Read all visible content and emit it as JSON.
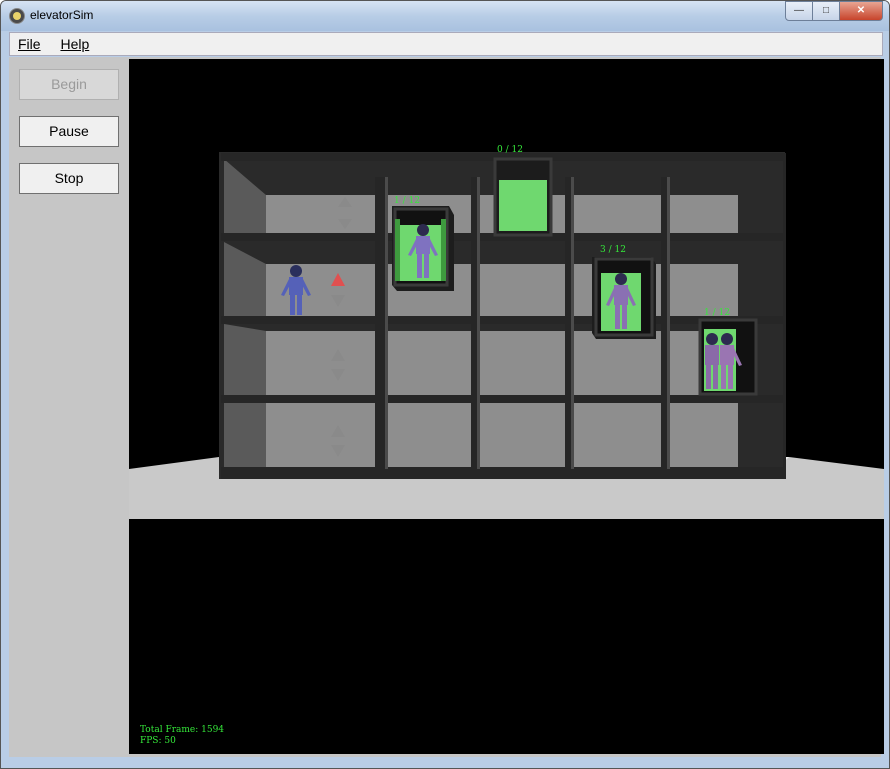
{
  "window": {
    "title": "elevatorSim"
  },
  "title_buttons": {
    "minimize": "—",
    "maximize": "□",
    "close": "✕"
  },
  "menu": {
    "file": "File",
    "help": "Help"
  },
  "sidebar": {
    "begin": "Begin",
    "pause": "Pause",
    "stop": "Stop"
  },
  "hud": {
    "total_frame": "Total Frame: 1594",
    "fps": "FPS: 50"
  },
  "elevators": [
    {
      "label": "0 / 12"
    },
    {
      "label": "1 / 12"
    },
    {
      "label": "3 / 12"
    },
    {
      "label": "1 / 12"
    }
  ],
  "colors": {
    "elevator_green": "#6fd86f",
    "call_up_active": "#e05050",
    "call_inactive": "#8a8a8a",
    "hud_text": "#35e83a"
  },
  "icons": {
    "up_arrow": "up-arrow-icon",
    "down_arrow": "down-arrow-icon",
    "person": "person-icon"
  }
}
